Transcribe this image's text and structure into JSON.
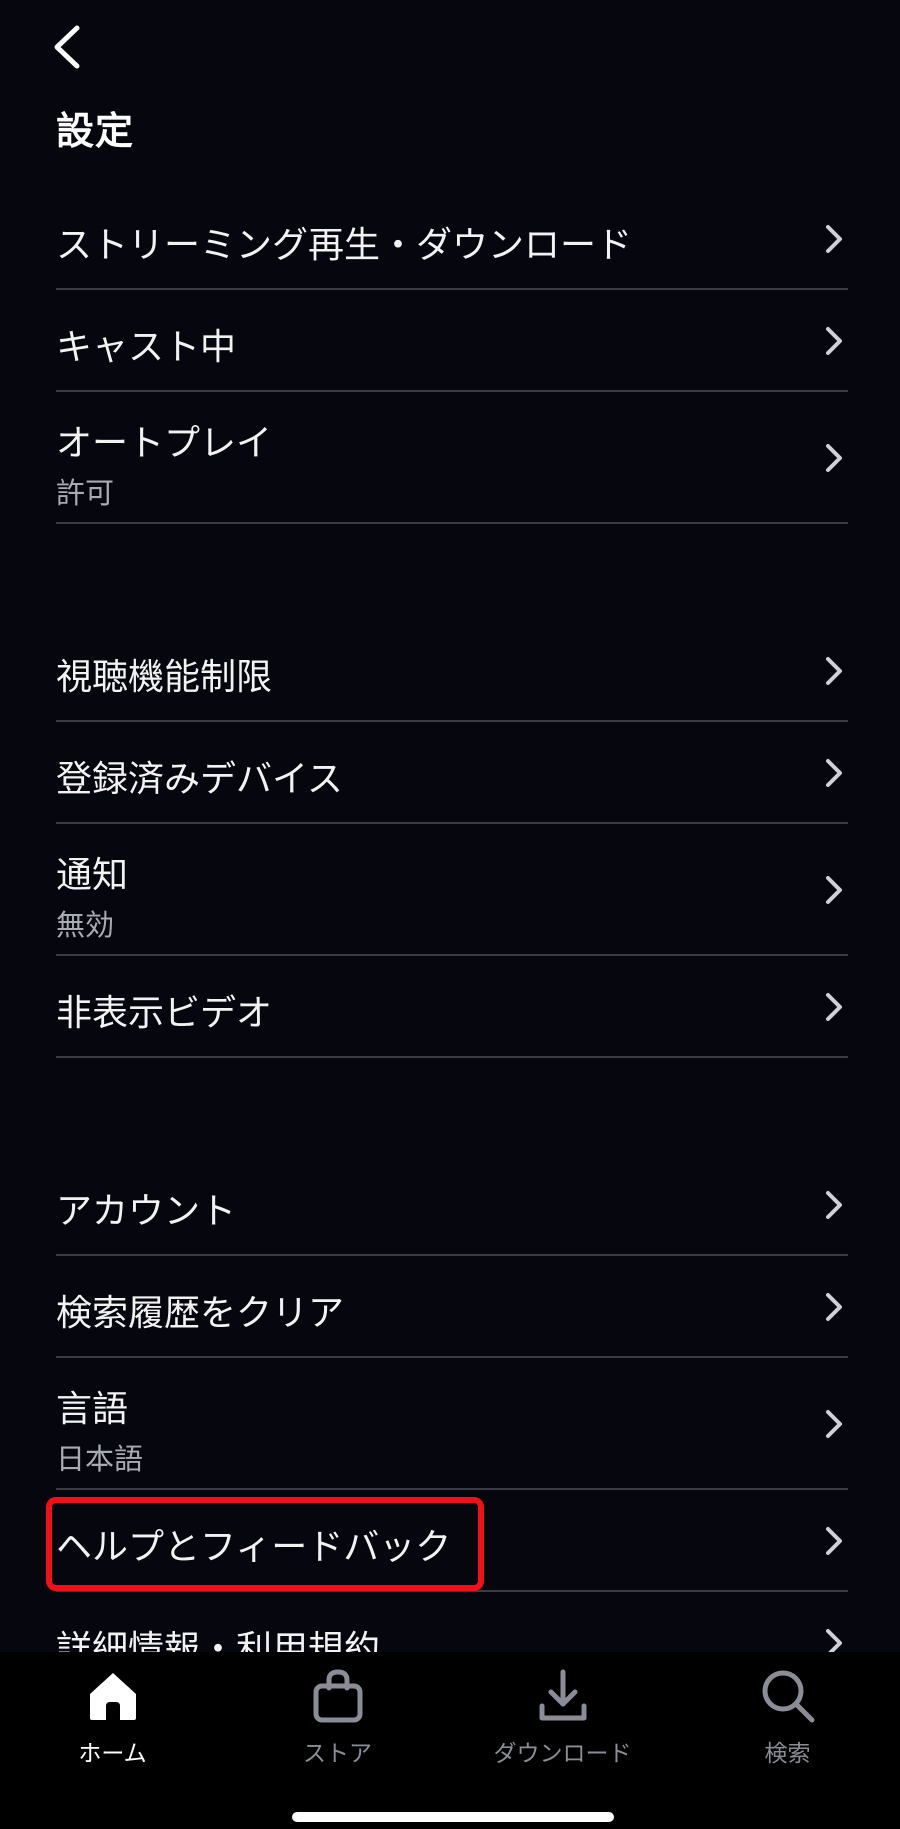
{
  "header": {
    "title": "設定",
    "back_icon": "chevron-left-icon"
  },
  "sections": [
    {
      "items": [
        {
          "id": "streaming",
          "label": "ストリーミング再生・ダウンロード",
          "sub": ""
        },
        {
          "id": "casting",
          "label": "キャスト中",
          "sub": ""
        },
        {
          "id": "autoplay",
          "label": "オートプレイ",
          "sub": "許可"
        }
      ]
    },
    {
      "items": [
        {
          "id": "parental",
          "label": "視聴機能制限",
          "sub": ""
        },
        {
          "id": "devices",
          "label": "登録済みデバイス",
          "sub": ""
        },
        {
          "id": "notifications",
          "label": "通知",
          "sub": "無効"
        },
        {
          "id": "hidden",
          "label": "非表示ビデオ",
          "sub": ""
        }
      ]
    },
    {
      "items": [
        {
          "id": "account",
          "label": "アカウント",
          "sub": ""
        },
        {
          "id": "clear-history",
          "label": "検索履歴をクリア",
          "sub": ""
        },
        {
          "id": "language",
          "label": "言語",
          "sub": "日本語"
        },
        {
          "id": "help",
          "label": "ヘルプとフィードバック",
          "sub": ""
        },
        {
          "id": "legal",
          "label": "詳細情報・利用規約",
          "sub": ""
        }
      ]
    }
  ],
  "highlight": {
    "target": "help",
    "color": "#f0101a"
  },
  "bottom_nav": [
    {
      "id": "home",
      "label": "ホーム",
      "icon": "home-icon",
      "active": true
    },
    {
      "id": "store",
      "label": "ストア",
      "icon": "shopping-bag-icon",
      "active": false
    },
    {
      "id": "downloads",
      "label": "ダウンロード",
      "icon": "download-icon",
      "active": false
    },
    {
      "id": "search",
      "label": "検索",
      "icon": "search-icon",
      "active": false
    }
  ],
  "colors": {
    "background": "#05060e",
    "divider": "#3a3c44",
    "text": "#f2f2f2",
    "subtext": "#a9abb3",
    "nav_inactive": "#8a8d96"
  }
}
